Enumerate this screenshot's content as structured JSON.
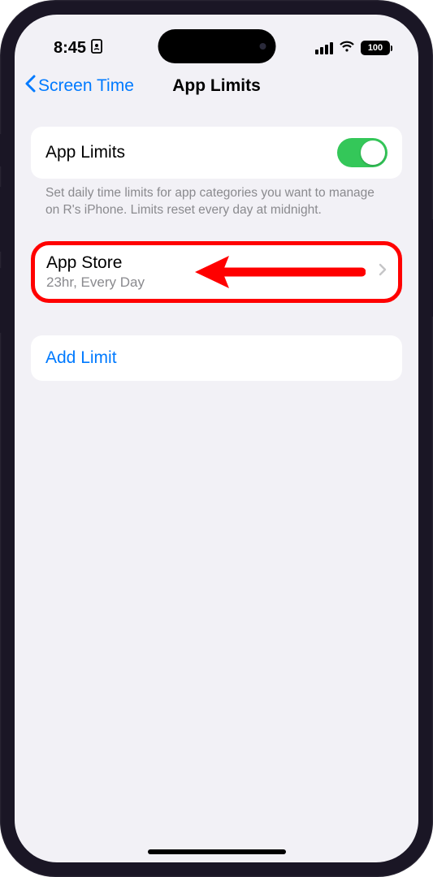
{
  "status_bar": {
    "time": "8:45",
    "battery_text": "100"
  },
  "nav": {
    "back_label": "Screen Time",
    "title": "App Limits"
  },
  "main": {
    "toggle_label": "App Limits",
    "toggle_on": true,
    "description": "Set daily time limits for app categories you want to manage on R's iPhone. Limits reset every day at midnight.",
    "limit_item": {
      "title": "App Store",
      "subtitle": "23hr, Every Day"
    },
    "add_limit_label": "Add Limit"
  }
}
